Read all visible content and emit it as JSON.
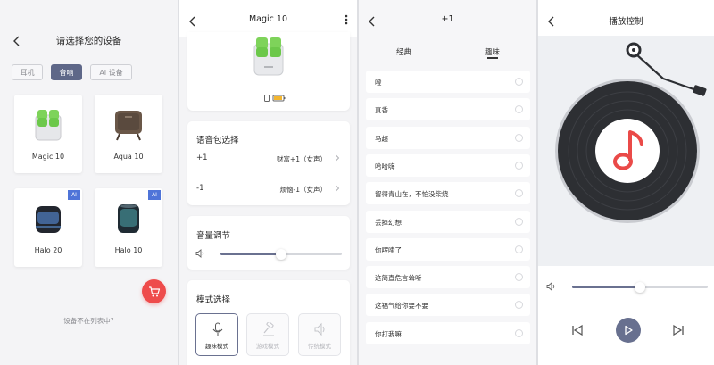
{
  "screen1": {
    "title": "请选择您的设备",
    "tabs": [
      "耳机",
      "音响",
      "AI 设备"
    ],
    "active_tab_index": 1,
    "devices": [
      {
        "label": "Magic 10",
        "ai": false
      },
      {
        "label": "Aqua 10",
        "ai": false
      },
      {
        "label": "Halo 20",
        "ai": true
      },
      {
        "label": "Halo 10",
        "ai": true
      }
    ],
    "ai_badge": "AI",
    "footer": "设备不在列表中?",
    "fab_icon": "cart-icon",
    "accent": "#ee4b4b",
    "primary": "#5e6788"
  },
  "screen2": {
    "title": "Magic 10",
    "voice": {
      "title": "语音包选择",
      "rows": [
        {
          "key": "+1",
          "value": "财富+1（女声）"
        },
        {
          "key": "-1",
          "value": "烦恼-1（女声）"
        }
      ]
    },
    "volume": {
      "title": "音量调节",
      "level": 0.5
    },
    "mode": {
      "title": "模式选择",
      "buttons": [
        {
          "label": "趣味模式",
          "icon": "microphone-icon",
          "active": true
        },
        {
          "label": "游戏模式",
          "icon": "gavel-icon",
          "active": false
        },
        {
          "label": "传统模式",
          "icon": "speaker-icon",
          "active": false
        }
      ]
    }
  },
  "screen3": {
    "title": "+1",
    "tabs": [
      "经典",
      "趣味"
    ],
    "active_tab_index": 1,
    "items": [
      "噔",
      "真香",
      "马超",
      "哈哈嗨",
      "留得青山在，不怕没柴烧",
      "丢掉幻想",
      "你啰嗦了",
      "这简直危言耸听",
      "这福气给你要不要",
      "你打我嘛"
    ]
  },
  "screen4": {
    "title": "播放控制",
    "volume_level": 0.5,
    "controls": [
      "previous-icon",
      "play-icon",
      "next-icon"
    ]
  }
}
